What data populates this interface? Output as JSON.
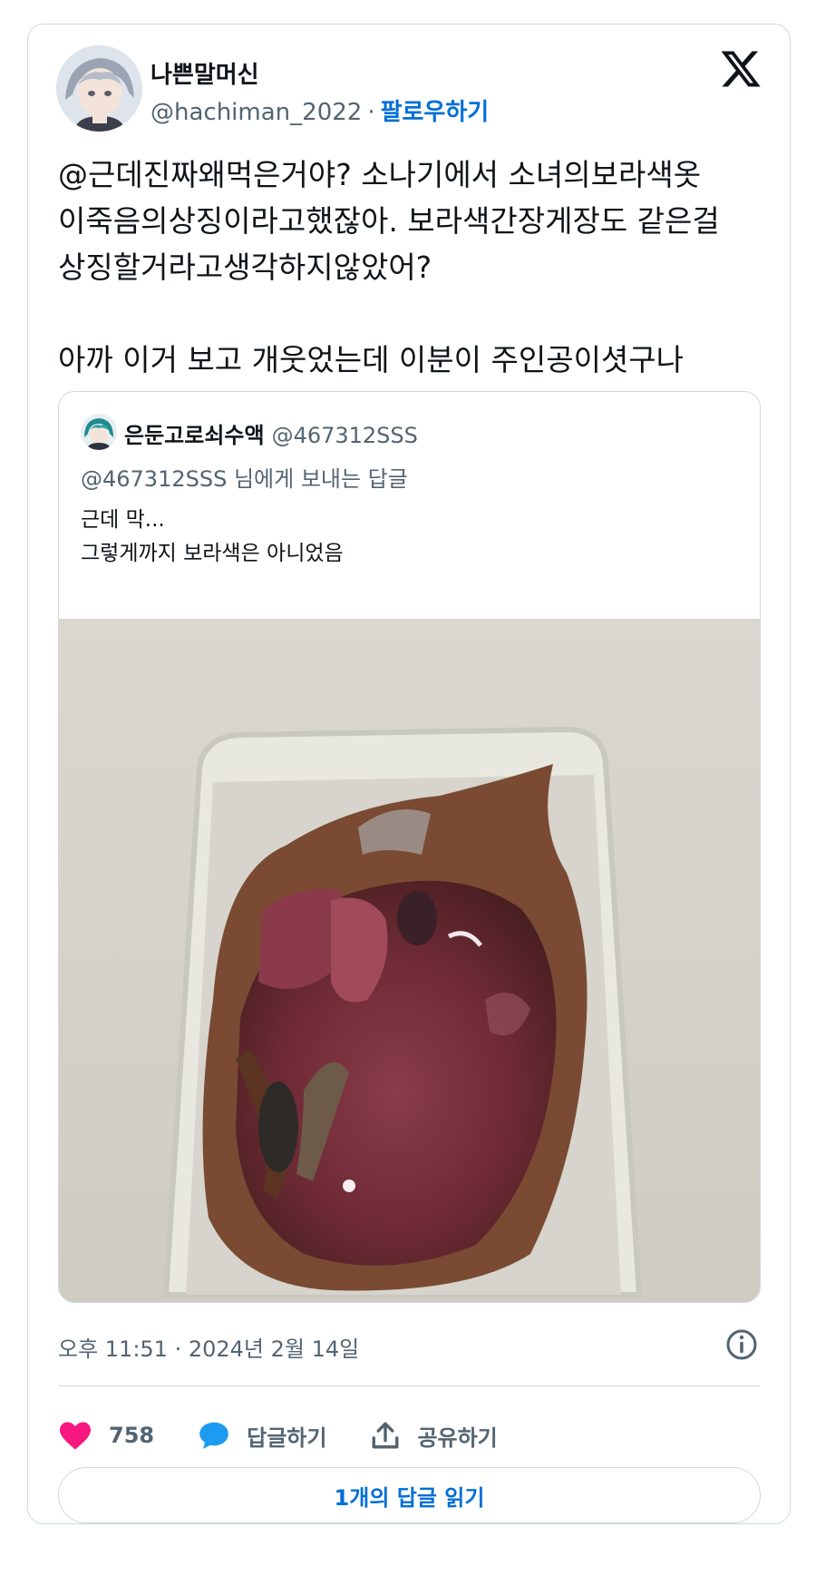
{
  "author": {
    "name": "나쁜말머신",
    "handle": "@hachiman_2022",
    "separator": "·",
    "follow_label": "팔로우하기"
  },
  "tweet": {
    "text": "@근데진짜왜먹은거야? 소나기에서 소녀의보라색옷\n이죽음의상징이라고했잖아. 보라색간장게장도 같은걸\n상징할거라고생각하지않았어?\n\n아까 이거 보고 개웃었는데 이분이 주인공이셧구나"
  },
  "quoted": {
    "name": "은둔고로쇠수액",
    "handle": "@467312SSS",
    "reply_to": "@467312SSS 님에게 보내는 답글",
    "text": "근데 막...\n그렇게까지 보라색은 아니었음"
  },
  "timestamp": "오후 11:51 · 2024년 2월 14일",
  "actions": {
    "likes": "758",
    "reply_label": "답글하기",
    "share_label": "공유하기"
  },
  "read_replies_label": "1개의 답글 읽기",
  "colors": {
    "link": "#006fd6",
    "like": "#f91880",
    "reply_icon": "#1d9bf0",
    "muted": "#536471"
  }
}
